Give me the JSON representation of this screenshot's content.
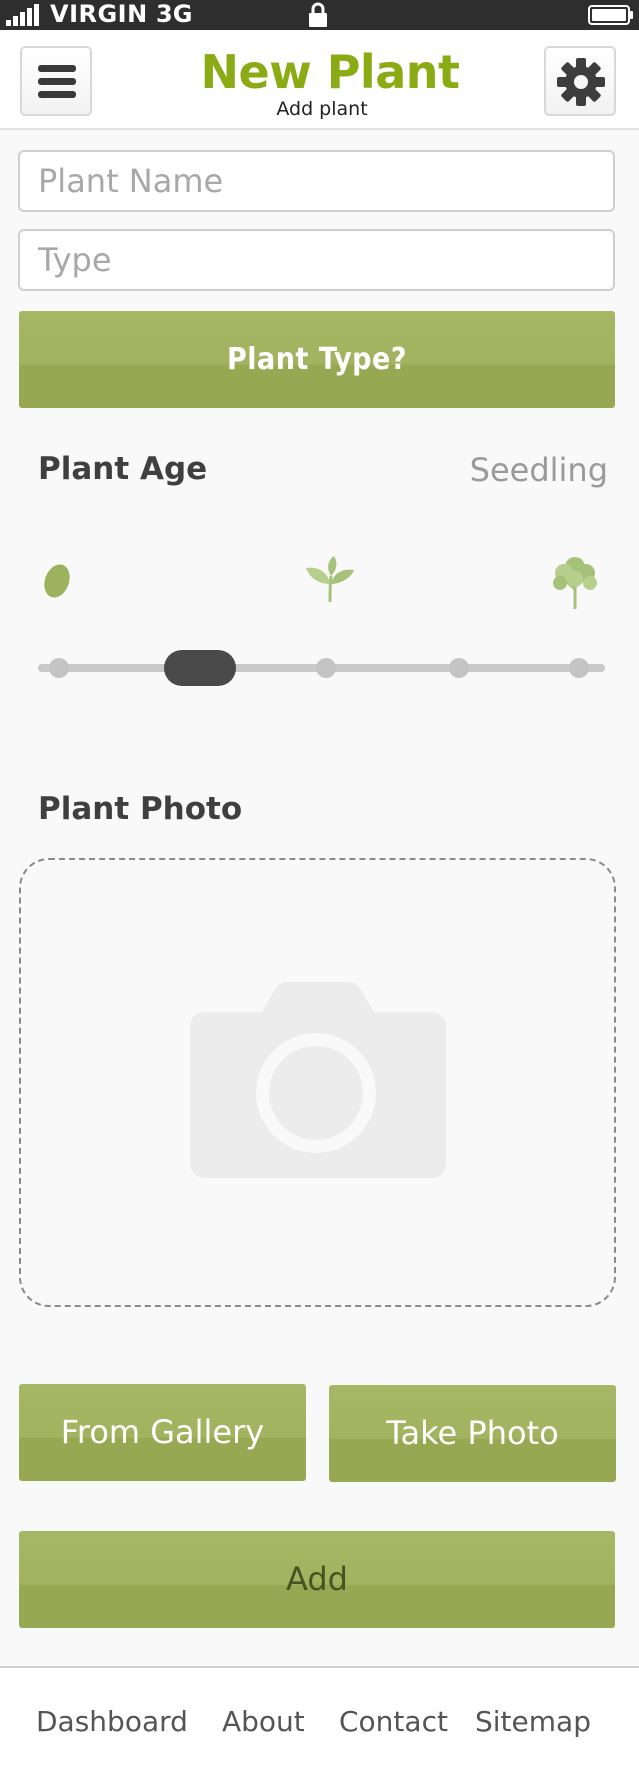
{
  "status_bar": {
    "carrier": "VIRGIN",
    "network": "3G"
  },
  "header": {
    "title": "New Plant",
    "subtitle": "Add plant"
  },
  "form": {
    "plant_name_placeholder": "Plant Name",
    "type_placeholder": "Type",
    "plant_type_button": "Plant Type?"
  },
  "plant_age": {
    "label": "Plant Age",
    "value": "Seedling",
    "slider_steps": 5,
    "slider_selected_step": 2,
    "stages": [
      "seed",
      "sprout",
      "tree"
    ]
  },
  "plant_photo": {
    "label": "Plant Photo",
    "gallery_button": "From Gallery",
    "take_photo_button": "Take Photo"
  },
  "add_button": "Add",
  "footer": {
    "links": [
      "Dashboard",
      "About",
      "Contact",
      "Sitemap"
    ]
  },
  "colors": {
    "accent": "#8aab14",
    "button_green": "#9cad59",
    "icon_green": "#a6c27a"
  }
}
